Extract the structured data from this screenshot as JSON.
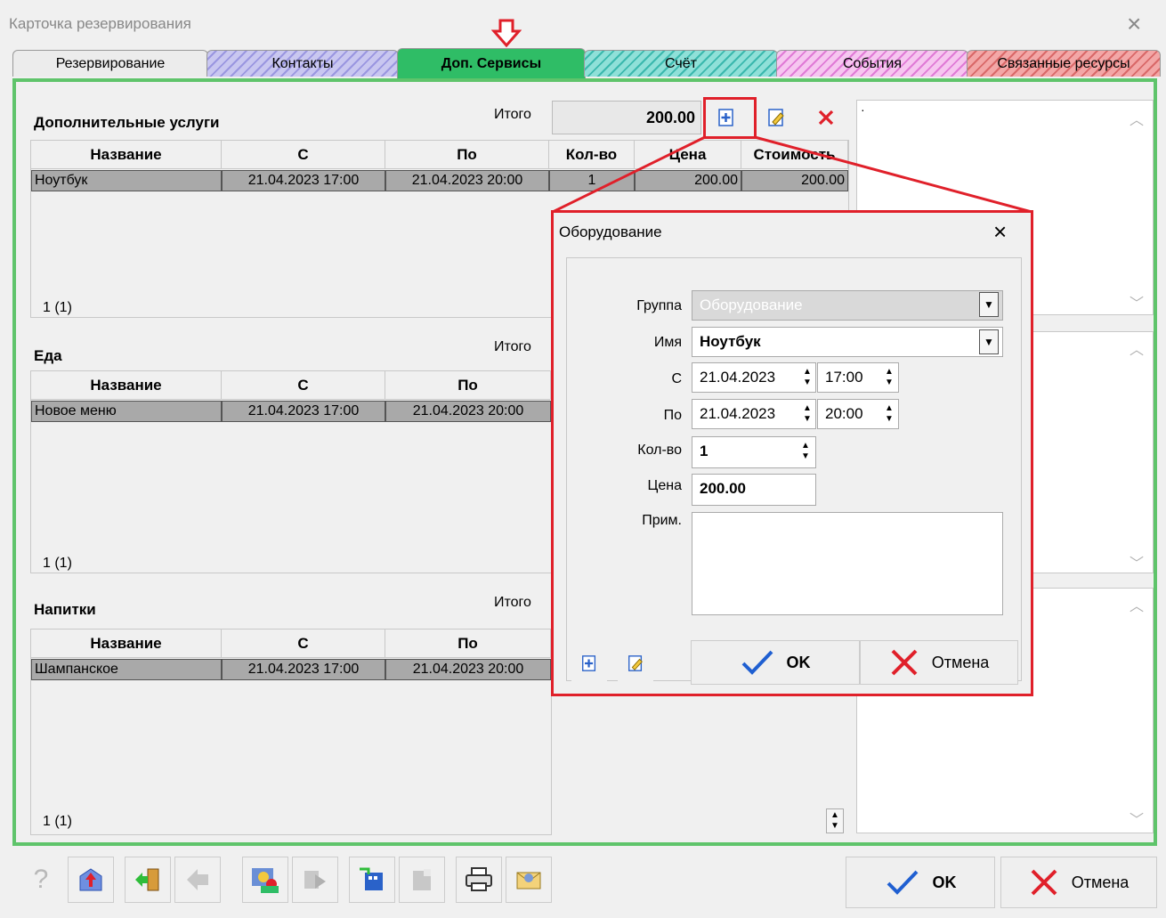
{
  "window": {
    "title": "Карточка резервирования",
    "close_glyph": "×"
  },
  "tabs": [
    {
      "label": "Резервирование"
    },
    {
      "label": "Контакты"
    },
    {
      "label": "Доп. Сервисы"
    },
    {
      "label": "Счёт"
    },
    {
      "label": "События"
    },
    {
      "label": "Связанные ресурсы"
    }
  ],
  "active_tab_color": "#2fbd66",
  "frame_color": "#5fc46b",
  "highlight_color": "#e0202a",
  "sections": {
    "extra": {
      "title": "Дополнительные услуги",
      "itogo_label": "Итого",
      "total": "200.00",
      "columns": [
        "Название",
        "С",
        "По",
        "Кол-во",
        "Цена",
        "Стоимость"
      ],
      "row": [
        "Ноутбук",
        "21.04.2023 17:00",
        "21.04.2023 20:00",
        "1",
        "200.00",
        "200.00"
      ],
      "counter": "1 (1)"
    },
    "food": {
      "title": "Еда",
      "itogo_label": "Итого",
      "columns": [
        "Название",
        "С",
        "По"
      ],
      "row": [
        "Новое меню",
        "21.04.2023 17:00",
        "21.04.2023 20:00"
      ],
      "counter": "1 (1)"
    },
    "drinks": {
      "title": "Напитки",
      "itogo_label": "Итого",
      "columns": [
        "Название",
        "С",
        "По"
      ],
      "row": [
        "Шампанское",
        "21.04.2023 17:00",
        "21.04.2023 20:00"
      ],
      "counter": "1 (1)"
    }
  },
  "right_panel": {
    "note_text": "·"
  },
  "dialog": {
    "title": "Оборудование",
    "close_glyph": "×",
    "group_label": "Группа",
    "group_value": "Оборудование",
    "name_label": "Имя",
    "name_value": "Ноутбук",
    "from_label": "С",
    "from_date": "21.04.2023",
    "from_time": "17:00",
    "to_label": "По",
    "to_date": "21.04.2023",
    "to_time": "20:00",
    "qty_label": "Кол-во",
    "qty_value": "1",
    "price_label": "Цена",
    "price_value": "200.00",
    "note_label": "Прим.",
    "ok_label": "OK",
    "cancel_label": "Отмена"
  },
  "footer": {
    "ok_label": "OK",
    "cancel_label": "Отмена",
    "help_glyph": "?"
  }
}
